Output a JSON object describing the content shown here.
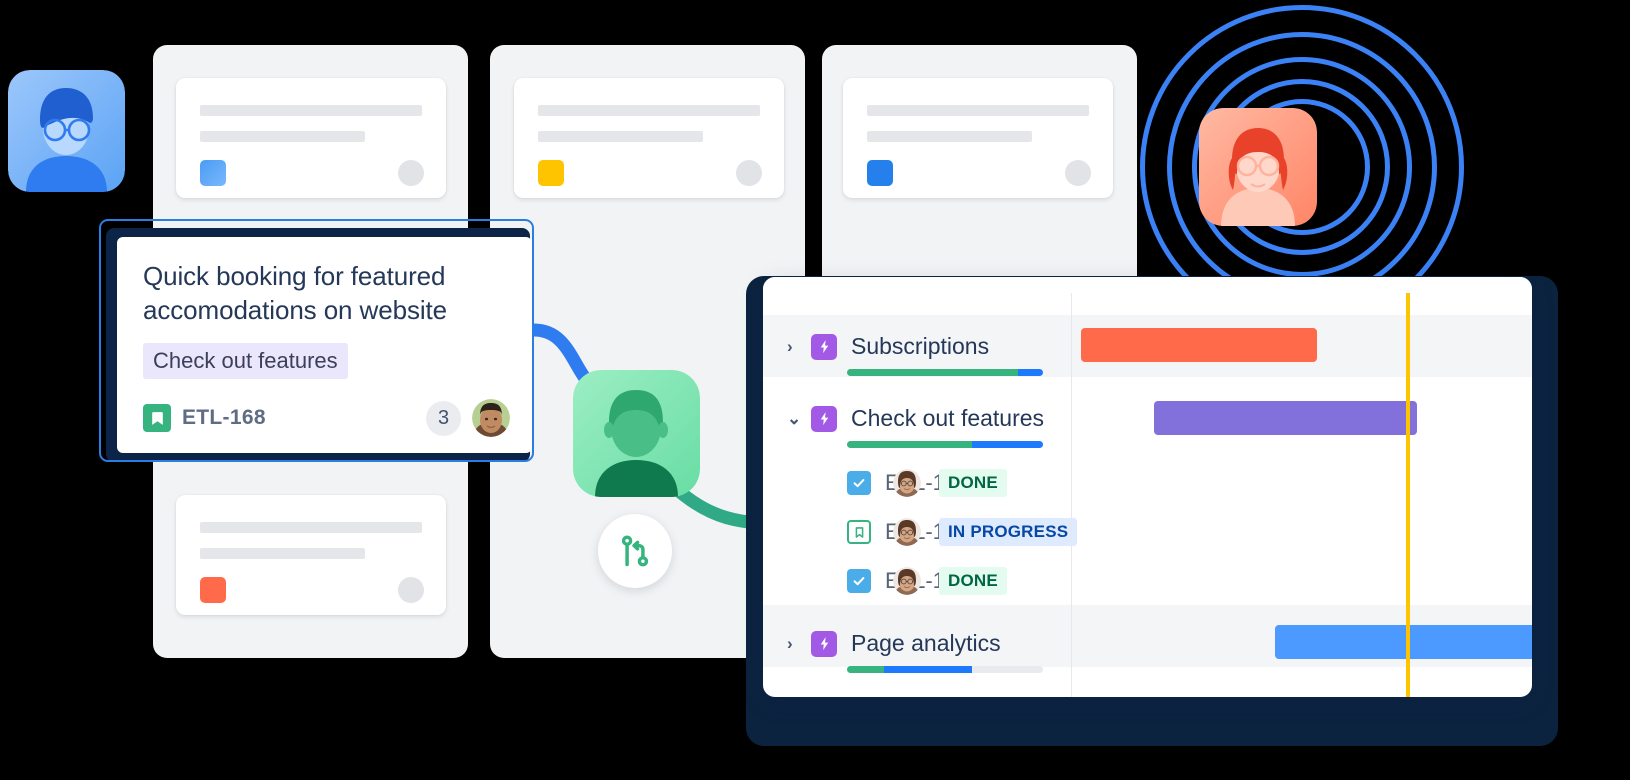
{
  "board": {
    "columns": [
      {
        "name": "column-1",
        "card": {
          "swatch_color": "#3b82f6",
          "swatch_name": "blue-swatch"
        }
      },
      {
        "name": "column-2",
        "card": {
          "swatch_color": "#ffc400",
          "swatch_name": "yellow-swatch"
        }
      },
      {
        "name": "column-3",
        "card": {
          "swatch_color": "#2680eb",
          "swatch_name": "blue-swatch"
        }
      }
    ],
    "extra_card": {
      "swatch_color": "#ff6b4a",
      "swatch_name": "orange-swatch"
    }
  },
  "issue_card": {
    "title": "Quick booking for featured accomodations on website",
    "epic_label": "Check out features",
    "epic_bg": "#eae6fb",
    "key": "ETL-168",
    "key_icon": "story-bookmark-icon",
    "key_icon_color": "#36b37e",
    "comment_count": "3",
    "avatar": "user-avatar-male",
    "border_color": "#2a7de1"
  },
  "avatars": {
    "blue_tile": "avatar-blue-man-glasses",
    "green_tile": "avatar-green-person",
    "red_tile": "avatar-red-woman-glasses"
  },
  "rings": {
    "color": "#3b82f6",
    "count": 5
  },
  "git_icon": {
    "name": "git-branch-icon",
    "color": "#36b37e"
  },
  "timeline": {
    "today_marker_color": "#ffc400",
    "rows": [
      {
        "type": "epic",
        "chevron": "›",
        "expanded": false,
        "name": "Subscriptions",
        "icon": "epic-lightning-icon",
        "icon_color": "#a259e6",
        "progress": {
          "green_pct": 87,
          "blue_pct": 13,
          "grey_pct": 0
        },
        "bar": {
          "color": "#ff6b4a",
          "left_pct": 2,
          "width_pct": 51,
          "name": "gantt-bar-subscriptions"
        },
        "shaded": true
      },
      {
        "type": "epic",
        "chevron": "⌄",
        "expanded": true,
        "name": "Check out features",
        "icon": "epic-lightning-icon",
        "icon_color": "#a259e6",
        "progress": {
          "green_pct": 64,
          "blue_pct": 36,
          "grey_pct": 0
        },
        "bar": {
          "color": "#8270db",
          "left_pct": 21,
          "width_pct": 58,
          "name": "gantt-bar-check-out-features"
        },
        "shaded": false
      },
      {
        "type": "child",
        "key": "ETL-160",
        "icon": "task-check-icon",
        "icon_kind": "task",
        "avatar": "user-avatar-female",
        "status": "DONE",
        "status_kind": "done"
      },
      {
        "type": "child",
        "key": "ETL-168",
        "icon": "story-bookmark-icon",
        "icon_kind": "story",
        "avatar": "user-avatar-female",
        "status": "IN PROGRESS",
        "status_kind": "inprogress"
      },
      {
        "type": "child",
        "key": "ETL-174",
        "icon": "task-check-icon",
        "icon_kind": "task",
        "avatar": "user-avatar-female",
        "status": "DONE",
        "status_kind": "done"
      },
      {
        "type": "epic",
        "chevron": "›",
        "expanded": false,
        "name": "Page analytics",
        "icon": "epic-lightning-icon",
        "icon_color": "#a259e6",
        "progress": {
          "green_pct": 19,
          "blue_pct": 45,
          "grey_pct": 36
        },
        "bar": {
          "color": "#4c9aff",
          "left_pct": 44,
          "width_pct": 56,
          "name": "gantt-bar-page-analytics"
        },
        "shaded": true
      }
    ]
  }
}
